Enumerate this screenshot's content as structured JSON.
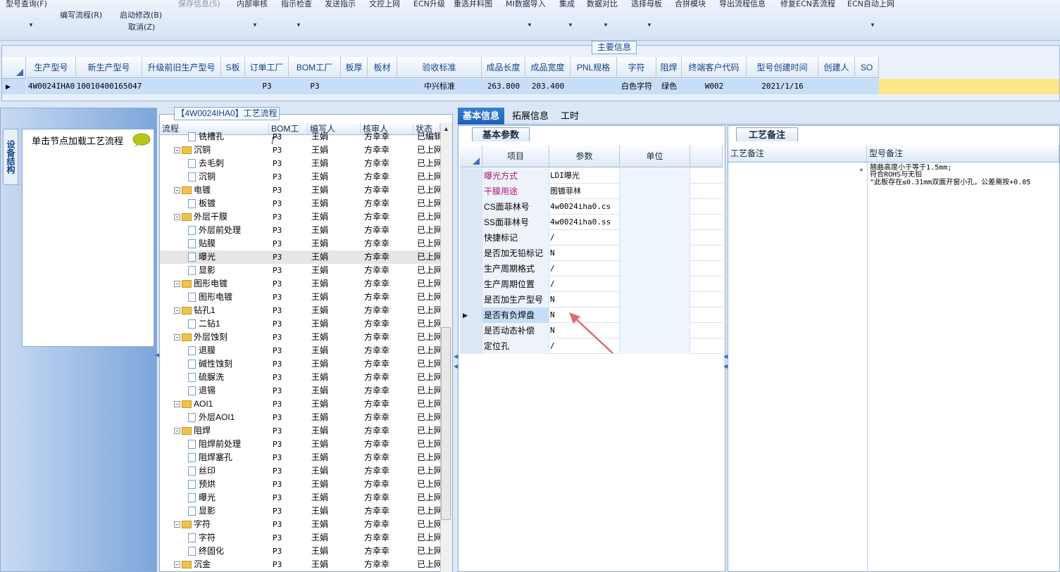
{
  "toolbar": {
    "items": [
      {
        "label": "型号查询(F)"
      },
      {
        "label": "编写流程(R)"
      },
      {
        "label": "启动修改(B)"
      },
      {
        "label": "取消(Z)"
      },
      {
        "label": "保存信息(S)"
      },
      {
        "label": "内部审核"
      },
      {
        "label": "指示检查"
      },
      {
        "label": "发送指示"
      },
      {
        "label": "文控上网"
      },
      {
        "label": "ECN升级"
      },
      {
        "label": "重选并料图"
      },
      {
        "label": "MI数据导入"
      },
      {
        "label": "集成"
      },
      {
        "label": "数据对比"
      },
      {
        "label": "选择母板"
      },
      {
        "label": "合拼模块"
      },
      {
        "label": "导出流程信息"
      },
      {
        "label": "修复ECN丢流程"
      },
      {
        "label": "ECN自动上网"
      }
    ]
  },
  "main_info": {
    "section_title": "主要信息",
    "columns": [
      "生产型号",
      "新生产型号",
      "升级前旧生产型号",
      "S板",
      "订单工厂",
      "BOM工厂",
      "板厚",
      "板材",
      "验收标准",
      "成品长度",
      "成品宽度",
      "PNL规格",
      "字符",
      "阻焊",
      "终端客户代码",
      "型号创建时间",
      "创建人",
      "SO"
    ],
    "row": [
      "4W0024IHA0",
      "10010400165047",
      "",
      "",
      "P3",
      "P3",
      "",
      "",
      "中兴标准",
      "263.800",
      "203.400",
      "",
      "白色字符",
      "绿色",
      "W002",
      "2021/1/16",
      "",
      ""
    ]
  },
  "left_panel": {
    "vertical_tab": "设备结构",
    "click_hint": "单击节点加载工艺流程"
  },
  "tree": {
    "title": "【4W0024IHA0】工艺流程",
    "columns": [
      "流程",
      "BOM工厂",
      "编写人",
      "核审人",
      "状态"
    ],
    "rows": [
      {
        "name": "铣槽孔",
        "level": 2,
        "type": "page",
        "bom": "P3",
        "writer": "王娟",
        "checker": "方幸幸",
        "status": "已编辑"
      },
      {
        "name": "沉铜",
        "level": 1,
        "type": "folder",
        "bom": "P3",
        "writer": "王娟",
        "checker": "方幸幸",
        "status": "已上网"
      },
      {
        "name": "去毛刺",
        "level": 2,
        "type": "page",
        "bom": "P3",
        "writer": "王娟",
        "checker": "方幸幸",
        "status": "已上网"
      },
      {
        "name": "沉铜",
        "level": 2,
        "type": "page",
        "bom": "P3",
        "writer": "王娟",
        "checker": "方幸幸",
        "status": "已上网"
      },
      {
        "name": "电镀",
        "level": 1,
        "type": "folder",
        "bom": "P3",
        "writer": "王娟",
        "checker": "方幸幸",
        "status": "已上网"
      },
      {
        "name": "板镀",
        "level": 2,
        "type": "page",
        "bom": "P3",
        "writer": "王娟",
        "checker": "方幸幸",
        "status": "已上网"
      },
      {
        "name": "外层干膜",
        "level": 1,
        "type": "folder",
        "bom": "P3",
        "writer": "王娟",
        "checker": "方幸幸",
        "status": "已上网"
      },
      {
        "name": "外层前处理",
        "level": 2,
        "type": "page",
        "bom": "P3",
        "writer": "王娟",
        "checker": "方幸幸",
        "status": "已上网"
      },
      {
        "name": "贴膜",
        "level": 2,
        "type": "page",
        "bom": "P3",
        "writer": "王娟",
        "checker": "方幸幸",
        "status": "已上网"
      },
      {
        "name": "曝光",
        "level": 2,
        "type": "page",
        "bom": "P3",
        "writer": "王娟",
        "checker": "方幸幸",
        "status": "已上网",
        "selected": true
      },
      {
        "name": "显影",
        "level": 2,
        "type": "page",
        "bom": "P3",
        "writer": "王娟",
        "checker": "方幸幸",
        "status": "已上网"
      },
      {
        "name": "图形电镀",
        "level": 1,
        "type": "folder",
        "bom": "P3",
        "writer": "王娟",
        "checker": "方幸幸",
        "status": "已上网"
      },
      {
        "name": "图形电镀",
        "level": 2,
        "type": "page",
        "bom": "P3",
        "writer": "王娟",
        "checker": "方幸幸",
        "status": "已上网"
      },
      {
        "name": "钻孔1",
        "level": 1,
        "type": "folder",
        "bom": "P3",
        "writer": "王娟",
        "checker": "方幸幸",
        "status": "已上网"
      },
      {
        "name": "二钻1",
        "level": 2,
        "type": "page",
        "bom": "P3",
        "writer": "王娟",
        "checker": "方幸幸",
        "status": "已上网"
      },
      {
        "name": "外层蚀刻",
        "level": 1,
        "type": "folder",
        "bom": "P3",
        "writer": "王娟",
        "checker": "方幸幸",
        "status": "已上网"
      },
      {
        "name": "退膜",
        "level": 2,
        "type": "page",
        "bom": "P3",
        "writer": "王娟",
        "checker": "方幸幸",
        "status": "已上网"
      },
      {
        "name": "碱性蚀刻",
        "level": 2,
        "type": "page",
        "bom": "P3",
        "writer": "王娟",
        "checker": "方幸幸",
        "status": "已上网"
      },
      {
        "name": "硫脲洗",
        "level": 2,
        "type": "page",
        "bom": "P3",
        "writer": "王娟",
        "checker": "方幸幸",
        "status": "已上网"
      },
      {
        "name": "退锡",
        "level": 2,
        "type": "page",
        "bom": "P3",
        "writer": "王娟",
        "checker": "方幸幸",
        "status": "已上网"
      },
      {
        "name": "AOI1",
        "level": 1,
        "type": "folder",
        "bom": "P3",
        "writer": "王娟",
        "checker": "方幸幸",
        "status": "已上网"
      },
      {
        "name": "外层AOI1",
        "level": 2,
        "type": "page",
        "bom": "P3",
        "writer": "王娟",
        "checker": "方幸幸",
        "status": "已上网"
      },
      {
        "name": "阻焊",
        "level": 1,
        "type": "folder",
        "bom": "P3",
        "writer": "王娟",
        "checker": "方幸幸",
        "status": "已上网"
      },
      {
        "name": "阻焊前处理",
        "level": 2,
        "type": "page",
        "bom": "P3",
        "writer": "王娟",
        "checker": "方幸幸",
        "status": "已上网"
      },
      {
        "name": "阻焊塞孔",
        "level": 2,
        "type": "page",
        "bom": "P3",
        "writer": "王娟",
        "checker": "方幸幸",
        "status": "已上网"
      },
      {
        "name": "丝印",
        "level": 2,
        "type": "page",
        "bom": "P3",
        "writer": "王娟",
        "checker": "方幸幸",
        "status": "已上网"
      },
      {
        "name": "预烘",
        "level": 2,
        "type": "page",
        "bom": "P3",
        "writer": "王娟",
        "checker": "方幸幸",
        "status": "已上网"
      },
      {
        "name": "曝光",
        "level": 2,
        "type": "page",
        "bom": "P3",
        "writer": "王娟",
        "checker": "方幸幸",
        "status": "已上网"
      },
      {
        "name": "显影",
        "level": 2,
        "type": "page",
        "bom": "P3",
        "writer": "王娟",
        "checker": "方幸幸",
        "status": "已上网"
      },
      {
        "name": "字符",
        "level": 1,
        "type": "folder",
        "bom": "P3",
        "writer": "王娟",
        "checker": "方幸幸",
        "status": "已上网"
      },
      {
        "name": "字符",
        "level": 2,
        "type": "page",
        "bom": "P3",
        "writer": "王娟",
        "checker": "方幸幸",
        "status": "已上网"
      },
      {
        "name": "终固化",
        "level": 2,
        "type": "page",
        "bom": "P3",
        "writer": "王娟",
        "checker": "方幸幸",
        "status": "已上网"
      },
      {
        "name": "沉金",
        "level": 1,
        "type": "folder",
        "bom": "P3",
        "writer": "王娟",
        "checker": "方幸幸",
        "status": "已上网"
      }
    ]
  },
  "right_tabs": [
    {
      "label": "基本信息",
      "active": true
    },
    {
      "label": "拓展信息"
    },
    {
      "label": "工时"
    }
  ],
  "basic_params": {
    "title": "基本参数",
    "columns": [
      "项目",
      "参数",
      "单位"
    ],
    "rows": [
      {
        "item": "曝光方式",
        "value": "LDI曝光",
        "unit": "",
        "color": "#b0157a"
      },
      {
        "item": "干膜用途",
        "value": "图镀菲林",
        "unit": "",
        "color": "#b0157a"
      },
      {
        "item": "CS面菲林号",
        "value": "4w0024iha0.cs",
        "unit": ""
      },
      {
        "item": "SS面菲林号",
        "value": "4w0024iha0.ss",
        "unit": ""
      },
      {
        "item": "快捷标记",
        "value": "/",
        "unit": ""
      },
      {
        "item": "是否加无铅标记",
        "value": "N",
        "unit": ""
      },
      {
        "item": "生产周期格式",
        "value": "/",
        "unit": ""
      },
      {
        "item": "生产周期位置",
        "value": "/",
        "unit": ""
      },
      {
        "item": "是否加生产型号",
        "value": "N",
        "unit": ""
      },
      {
        "item": "是否有负焊盘",
        "value": "N",
        "unit": "",
        "current": true
      },
      {
        "item": "是否动态补偿",
        "value": "N",
        "unit": ""
      },
      {
        "item": "定位孔",
        "value": "/",
        "unit": ""
      }
    ]
  },
  "notes": {
    "title": "工艺备注",
    "columns": [
      "工艺备注",
      "型号备注"
    ],
    "model_notes": [
      "翘曲高度小于等于1.5mm;",
      "符合ROHS与无铅",
      "\"此板存在≤0.31mm双面开窗小孔，公差需按+0.05"
    ]
  },
  "colors": {
    "accent": "#1b5fb5",
    "selected_row": "#c6def8",
    "yellow": "#fde68a",
    "arrow": "#e06a6a"
  }
}
